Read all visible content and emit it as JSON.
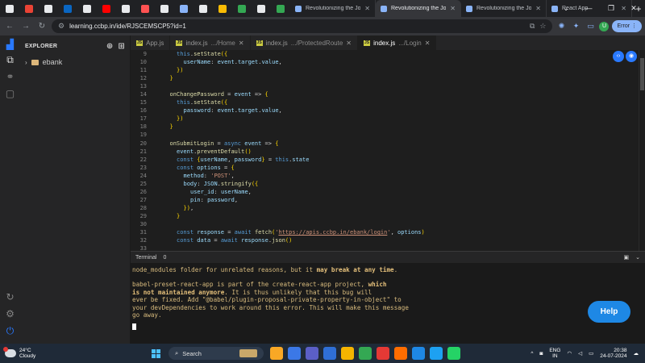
{
  "browser": {
    "mini_tabs": [
      {
        "icon": "generic-page-icon",
        "color": "#e8eaed"
      },
      {
        "icon": "gmail-icon",
        "color": "#ea4335"
      },
      {
        "icon": "generic-page-icon",
        "color": "#e8eaed"
      },
      {
        "icon": "linkedin-icon",
        "color": "#0a66c2"
      },
      {
        "icon": "generic-page-icon",
        "color": "#e8eaed"
      },
      {
        "icon": "youtube-icon",
        "color": "#ff0000"
      },
      {
        "icon": "generic-page-icon",
        "color": "#e8eaed"
      },
      {
        "icon": "app-icon",
        "color": "#ff5252"
      },
      {
        "icon": "generic-page-icon",
        "color": "#e8eaed"
      },
      {
        "icon": "spark-icon",
        "color": "#8ab4f8"
      },
      {
        "icon": "generic-page-icon",
        "color": "#e8eaed"
      },
      {
        "icon": "bolt-icon",
        "color": "#fbbc04"
      },
      {
        "icon": "sheets-icon",
        "color": "#34a853"
      },
      {
        "icon": "generic-page-icon",
        "color": "#e8eaed"
      },
      {
        "icon": "sheets-icon",
        "color": "#34a853"
      }
    ],
    "tabs": [
      {
        "title": "Revolutionizing the Job M",
        "active": false
      },
      {
        "title": "Revolutionizing the Job M",
        "active": true
      },
      {
        "title": "Revolutionizing the Job M",
        "active": false
      },
      {
        "title": "React App",
        "active": false
      }
    ],
    "new_tab": "+",
    "url": "learning.ccbp.in/ide/RJSCEMSCP5?id=1",
    "avatar_letter": "U",
    "error_label": "Error"
  },
  "explorer": {
    "title": "EXPLORER",
    "folder": "ebank"
  },
  "editor_tabs": [
    {
      "name": "App.js",
      "sub": "",
      "active": false,
      "closable": false
    },
    {
      "name": "index.js",
      "sub": ".../Home",
      "active": false,
      "closable": true
    },
    {
      "name": "index.js",
      "sub": ".../ProtectedRoute",
      "active": false,
      "closable": true
    },
    {
      "name": "index.js",
      "sub": ".../Login",
      "active": true,
      "closable": true
    }
  ],
  "code_lines": [
    {
      "n": "9",
      "indent": 2,
      "seg": [
        [
          "this",
          "kw"
        ],
        [
          ".",
          ""
        ],
        [
          "setState",
          "fn"
        ],
        [
          "(",
          "pn"
        ],
        [
          "{",
          "pn"
        ]
      ]
    },
    {
      "n": "10",
      "indent": 3,
      "seg": [
        [
          "userName",
          "vr"
        ],
        [
          ": ",
          ""
        ],
        [
          "event",
          "vr"
        ],
        [
          ".",
          ""
        ],
        [
          "target",
          "vr"
        ],
        [
          ".",
          ""
        ],
        [
          "value",
          "vr"
        ],
        [
          ",",
          ""
        ]
      ]
    },
    {
      "n": "11",
      "indent": 2,
      "seg": [
        [
          "})",
          "pn"
        ]
      ]
    },
    {
      "n": "12",
      "indent": 1,
      "seg": [
        [
          "}",
          "pn"
        ]
      ]
    },
    {
      "n": "13",
      "indent": 0,
      "seg": []
    },
    {
      "n": "14",
      "indent": 1,
      "seg": [
        [
          "onChangePassword",
          "fn"
        ],
        [
          " = ",
          ""
        ],
        [
          "event",
          "vr"
        ],
        [
          " => ",
          ""
        ],
        [
          "{",
          "pn"
        ]
      ]
    },
    {
      "n": "15",
      "indent": 2,
      "seg": [
        [
          "this",
          "kw"
        ],
        [
          ".",
          ""
        ],
        [
          "setState",
          "fn"
        ],
        [
          "(",
          "pn"
        ],
        [
          "{",
          "pn"
        ]
      ]
    },
    {
      "n": "16",
      "indent": 3,
      "seg": [
        [
          "password",
          "vr"
        ],
        [
          ": ",
          ""
        ],
        [
          "event",
          "vr"
        ],
        [
          ".",
          ""
        ],
        [
          "target",
          "vr"
        ],
        [
          ".",
          ""
        ],
        [
          "value",
          "vr"
        ],
        [
          ",",
          ""
        ]
      ]
    },
    {
      "n": "17",
      "indent": 2,
      "seg": [
        [
          "})",
          "pn"
        ]
      ]
    },
    {
      "n": "18",
      "indent": 1,
      "seg": [
        [
          "}",
          "pn"
        ]
      ]
    },
    {
      "n": "19",
      "indent": 0,
      "seg": []
    },
    {
      "n": "20",
      "indent": 1,
      "seg": [
        [
          "onSubmitLogin",
          "fn"
        ],
        [
          " = ",
          ""
        ],
        [
          "async",
          "kw"
        ],
        [
          " ",
          ""
        ],
        [
          "event",
          "vr"
        ],
        [
          " => ",
          ""
        ],
        [
          "{",
          "pn"
        ]
      ]
    },
    {
      "n": "21",
      "indent": 2,
      "seg": [
        [
          "event",
          "vr"
        ],
        [
          ".",
          ""
        ],
        [
          "preventDefault",
          "fn"
        ],
        [
          "()",
          "pn"
        ]
      ]
    },
    {
      "n": "22",
      "indent": 2,
      "seg": [
        [
          "const",
          "kw"
        ],
        [
          " ",
          ""
        ],
        [
          "{",
          "pn"
        ],
        [
          "userName",
          "vr"
        ],
        [
          ", ",
          ""
        ],
        [
          "password",
          "vr"
        ],
        [
          "}",
          "pn"
        ],
        [
          " = ",
          ""
        ],
        [
          "this",
          "kw"
        ],
        [
          ".",
          ""
        ],
        [
          "state",
          "vr"
        ]
      ]
    },
    {
      "n": "23",
      "indent": 2,
      "seg": [
        [
          "const",
          "kw"
        ],
        [
          " ",
          ""
        ],
        [
          "options",
          "vr"
        ],
        [
          " = ",
          ""
        ],
        [
          "{",
          "pn"
        ]
      ]
    },
    {
      "n": "24",
      "indent": 3,
      "seg": [
        [
          "method",
          "vr"
        ],
        [
          ": ",
          ""
        ],
        [
          "'POST'",
          "st"
        ],
        [
          ",",
          ""
        ]
      ]
    },
    {
      "n": "25",
      "indent": 3,
      "seg": [
        [
          "body",
          "vr"
        ],
        [
          ": ",
          ""
        ],
        [
          "JSON",
          "vr"
        ],
        [
          ".",
          ""
        ],
        [
          "stringify",
          "fn"
        ],
        [
          "(",
          "pn"
        ],
        [
          "{",
          "pn"
        ]
      ]
    },
    {
      "n": "26",
      "indent": 4,
      "seg": [
        [
          "user_id",
          "vr"
        ],
        [
          ": ",
          ""
        ],
        [
          "userName",
          "vr"
        ],
        [
          ",",
          ""
        ]
      ]
    },
    {
      "n": "27",
      "indent": 4,
      "seg": [
        [
          "pin",
          "vr"
        ],
        [
          ": ",
          ""
        ],
        [
          "password",
          "vr"
        ],
        [
          ",",
          ""
        ]
      ]
    },
    {
      "n": "28",
      "indent": 3,
      "seg": [
        [
          "})",
          "pn"
        ],
        [
          ",",
          ""
        ]
      ]
    },
    {
      "n": "29",
      "indent": 2,
      "seg": [
        [
          "}",
          "pn"
        ]
      ]
    },
    {
      "n": "30",
      "indent": 0,
      "seg": []
    },
    {
      "n": "31",
      "indent": 2,
      "seg": [
        [
          "const",
          "kw"
        ],
        [
          " ",
          ""
        ],
        [
          "response",
          "vr"
        ],
        [
          " = ",
          ""
        ],
        [
          "await",
          "kw"
        ],
        [
          " ",
          ""
        ],
        [
          "fetch",
          "fn"
        ],
        [
          "(",
          "pn"
        ],
        [
          "'",
          "st"
        ],
        [
          "https://apis.ccbp.in/ebank/login",
          "st ul"
        ],
        [
          "'",
          "st"
        ],
        [
          ", ",
          ""
        ],
        [
          "options",
          "vr"
        ],
        [
          ")",
          "pn"
        ]
      ]
    },
    {
      "n": "32",
      "indent": 2,
      "seg": [
        [
          "const",
          "kw"
        ],
        [
          " ",
          ""
        ],
        [
          "data",
          "vr"
        ],
        [
          " = ",
          ""
        ],
        [
          "await",
          "kw"
        ],
        [
          " ",
          ""
        ],
        [
          "response",
          "vr"
        ],
        [
          ".",
          ""
        ],
        [
          "json",
          "fn"
        ],
        [
          "()",
          "pn"
        ]
      ]
    },
    {
      "n": "33",
      "indent": 0,
      "seg": []
    }
  ],
  "terminal": {
    "tab_label": "Terminal",
    "badge": "0",
    "lines": [
      {
        "parts": [
          [
            "node_modules folder for unrelated reasons, but it ",
            ""
          ],
          [
            "may break at any time",
            "b"
          ],
          [
            ".",
            ""
          ]
        ]
      },
      {
        "gap": true
      },
      {
        "parts": [
          [
            "babel-preset-react-app is part of the create-react-app project, ",
            ""
          ],
          [
            "which",
            "b"
          ]
        ]
      },
      {
        "parts": [
          [
            "is not maintained anymore",
            "b"
          ],
          [
            ". It is thus unlikely that this bug will",
            ""
          ]
        ]
      },
      {
        "parts": [
          [
            "ever be fixed. Add \"@babel/plugin-proposal-private-property-in-object\" to",
            ""
          ]
        ]
      },
      {
        "parts": [
          [
            "your devDependencies to work around this error. This will make this message",
            ""
          ]
        ]
      },
      {
        "parts": [
          [
            "go away.",
            ""
          ]
        ]
      }
    ]
  },
  "help_label": "Help",
  "taskbar": {
    "temp": "24°C",
    "condition": "Cloudy",
    "search": "Search",
    "apps": [
      "#f9a825",
      "#3b78e7",
      "#5b5fc7",
      "#2f6fd6",
      "#f5b400",
      "#34a853",
      "#e53935",
      "#ff6d00",
      "#1e88e5",
      "#1da1f2",
      "#25d366"
    ],
    "lang_top": "ENG",
    "lang_bottom": "IN",
    "time": "20:38",
    "date": "24-07-2024"
  },
  "colors": {
    "accent": "#2979ff",
    "help_button": "#1e88e5",
    "terminal_text": "#d7ba7d"
  }
}
